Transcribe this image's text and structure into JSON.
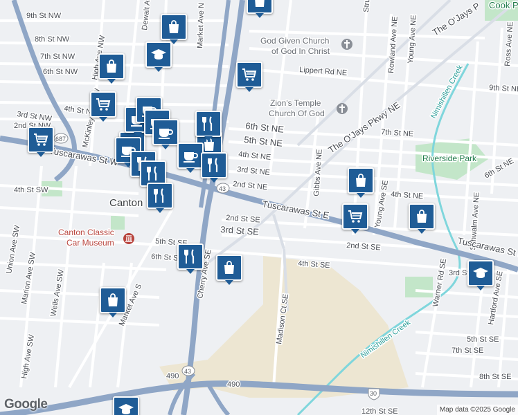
{
  "map": {
    "attribution": "Map data ©2025 Google",
    "logo_text": "Google",
    "colors": {
      "land": "#eef0f3",
      "highway": "#8fa6c6",
      "arterial": "#9db1cf",
      "street": "#ffffff",
      "park": "#c3e6c9",
      "industrial": "#ede6d2",
      "water": "#7fd6dc",
      "marker": "#1f5c96",
      "poi_red": "#b8453e"
    },
    "labels": {
      "streets": [
        "9th St NW",
        "8th St NW",
        "7th St NW",
        "6th St NW",
        "4th St NW",
        "3rd St NW",
        "2nd St NW",
        "Tuscarawas St W",
        "4th St SW",
        "McKinley Ave NW",
        "High Ave NW",
        "Market Ave N",
        "Dewalt Ave NW",
        "6th St NE",
        "5th St NE",
        "4th St NE",
        "3rd St NE",
        "2nd St NE",
        "Tuscarawas St E",
        "2nd St SE",
        "3rd St SE",
        "5th St SE",
        "6th St SE",
        "4th St SE",
        "Cherry Ave SE",
        "Madison Ct SE",
        "Gibbs Ave NE",
        "Struble Ave NE",
        "Rowland Ave NE",
        "Young Ave NE",
        "Lippert Rd NE",
        "7th St NE",
        "The O'Jays Pkwy NE",
        "9th St NE",
        "Ross Ave NE",
        "Young Ave SE",
        "2nd St SE",
        "4th St NE",
        "6th St NE",
        "Schwalm Ave NE",
        "Warner Rd SE",
        "Hartford Ave SE",
        "Tuscarawas St E",
        "3rd St SE",
        "5th St SE",
        "7th St SE",
        "8th St SE",
        "Union Ave SW",
        "Marion Ave SW",
        "Wells Ave SW",
        "High Ave SW",
        "Market Ave S",
        "490",
        "490",
        "12th St SE",
        "The O'Jays P"
      ],
      "city": "Canton",
      "pois": [
        {
          "name": "God Given Church\nof God In Christ",
          "kind": "church"
        },
        {
          "name": "Zion's Temple\nChurch Of God",
          "kind": "church"
        },
        {
          "name": "Canton Classic\nCar Museum",
          "kind": "museum"
        },
        {
          "name": "Riverside Park",
          "kind": "park"
        },
        {
          "name": "Nimishillen Creek",
          "kind": "water"
        },
        {
          "name": "Nimishillen Creek",
          "kind": "water"
        },
        {
          "name": "Cook P",
          "kind": "park"
        }
      ],
      "shields": [
        "687",
        "43",
        "43",
        "30"
      ]
    },
    "markers": [
      {
        "icon": "shopping-bag",
        "label": "Shopping"
      },
      {
        "icon": "shopping-cart",
        "label": "Grocery"
      },
      {
        "icon": "school-cap",
        "label": "School"
      },
      {
        "icon": "coffee-cup",
        "label": "Cafe"
      },
      {
        "icon": "fork-knife",
        "label": "Restaurant"
      }
    ]
  }
}
